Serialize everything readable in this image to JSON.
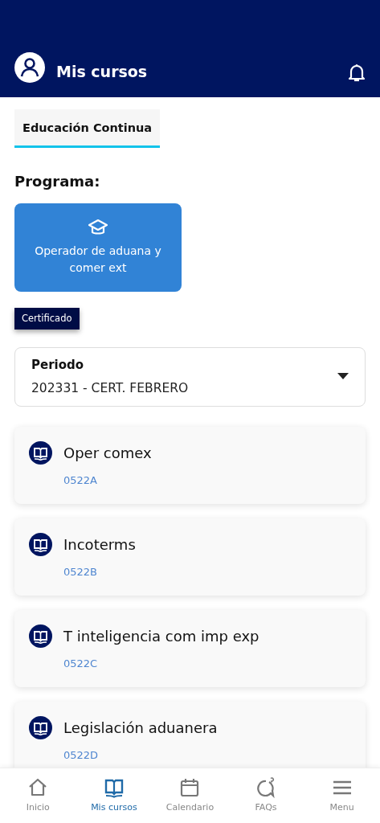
{
  "header": {
    "title": "Mis cursos"
  },
  "tabs": [
    {
      "label": "Educación Continua",
      "selected": true
    }
  ],
  "program_heading": "Programa:",
  "programs": [
    {
      "label": "Operador de aduana y comer ext",
      "selected": true
    }
  ],
  "badge": "Certificado",
  "period_select": {
    "label": "Periodo",
    "value": "202331 - CERT. FEBRERO"
  },
  "courses": [
    {
      "name": "Oper comex",
      "code": "0522A"
    },
    {
      "name": "Incoterms",
      "code": "0522B"
    },
    {
      "name": "T inteligencia com imp exp",
      "code": "0522C"
    },
    {
      "name": "Legislación aduanera",
      "code": "0522D"
    }
  ],
  "bottom_nav": [
    {
      "kind": "home",
      "label": "Inicio",
      "selected": false
    },
    {
      "kind": "book",
      "label": "Mis cursos",
      "selected": true
    },
    {
      "kind": "calendar",
      "label": "Calendario",
      "selected": false
    },
    {
      "kind": "faq",
      "label": "FAQs",
      "selected": false
    },
    {
      "kind": "menu",
      "label": "Menu",
      "selected": false
    }
  ]
}
